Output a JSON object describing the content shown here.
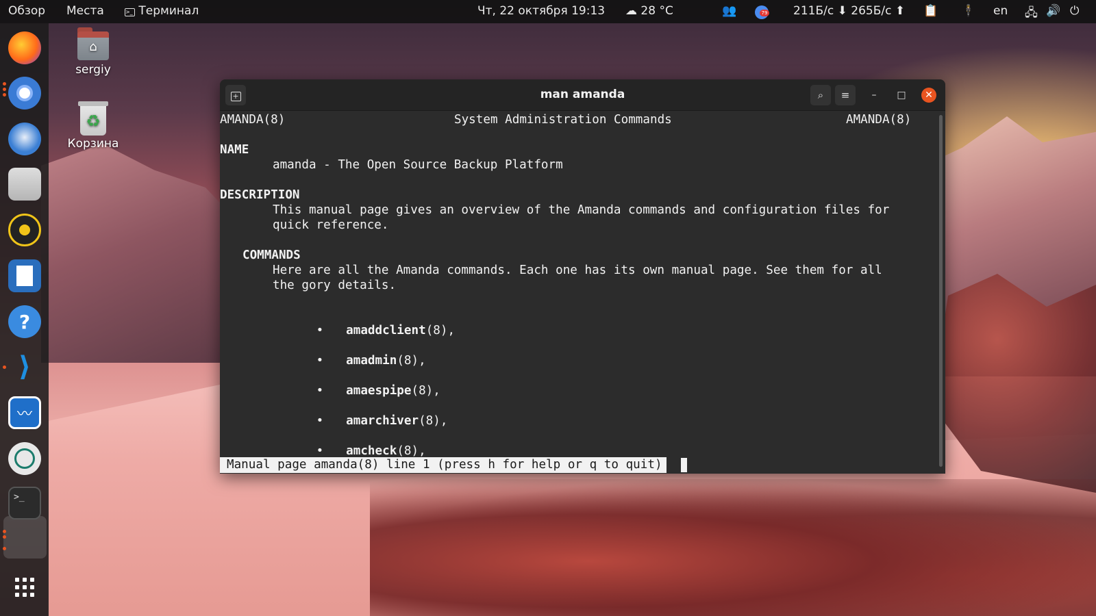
{
  "topbar": {
    "overview": "Обзор",
    "places": "Места",
    "active_app": "Терминал",
    "datetime": "Чт, 22 октября  19:13",
    "weather": "28 °C",
    "net_down": "211Б/с",
    "net_up": "265Б/с",
    "notification_count": "79",
    "language": "en"
  },
  "desktop": {
    "home_label": "sergiy",
    "trash_label": "Корзина"
  },
  "dock": {
    "apps": [
      "Firefox",
      "Chromium",
      "Thunderbird",
      "Files",
      "Rhythmbox",
      "LibreOffice Writer",
      "Help",
      "Visual Studio Code",
      "System Monitor",
      "Remote Desktop",
      "Terminal"
    ]
  },
  "window": {
    "title": "man amanda"
  },
  "terminal": {
    "header_left": "AMANDA(8)",
    "header_center": "System Administration Commands",
    "header_right": "AMANDA(8)",
    "name_heading": "NAME",
    "name_text": "amanda - The Open Source Backup Platform",
    "desc_heading": "DESCRIPTION",
    "desc_line1": "This manual page gives an overview of the Amanda commands and configuration files for",
    "desc_line2": "quick reference.",
    "commands_heading": "COMMANDS",
    "commands_line1": "Here are all the Amanda commands. Each one has its own manual page. See them for all",
    "commands_line2": "the gory details.",
    "bullet": "•",
    "commands": [
      {
        "name": "amaddclient",
        "suffix": "(8),"
      },
      {
        "name": "amadmin",
        "suffix": "(8),"
      },
      {
        "name": "amaespipe",
        "suffix": "(8),"
      },
      {
        "name": "amarchiver",
        "suffix": "(8),"
      },
      {
        "name": "amcheck",
        "suffix": "(8),"
      }
    ],
    "status": "Manual page amanda(8) line 1 (press h for help or q to quit)"
  },
  "colors": {
    "accent": "#e95420",
    "terminal_bg": "#2c2c2c",
    "terminal_fg": "#f2f2f2"
  }
}
